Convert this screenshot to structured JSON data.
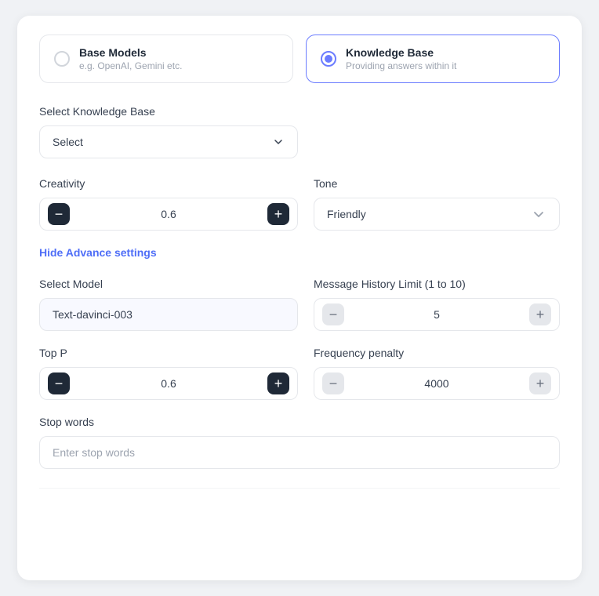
{
  "options": [
    {
      "id": "base-models",
      "title": "Base Models",
      "subtitle": "e.g. OpenAI, Gemini etc.",
      "selected": false
    },
    {
      "id": "knowledge-base",
      "title": "Knowledge Base",
      "subtitle": "Providing answers within it",
      "selected": true
    }
  ],
  "knowledge_base": {
    "label": "Select Knowledge Base",
    "placeholder": "Select",
    "chevron": "▾"
  },
  "creativity": {
    "label": "Creativity",
    "value": "0.6",
    "min_btn": "−",
    "max_btn": "+"
  },
  "tone": {
    "label": "Tone",
    "value": "Friendly",
    "chevron": "⌄"
  },
  "advance_toggle": {
    "label": "Hide Advance settings"
  },
  "select_model": {
    "label": "Select Model",
    "value": "Text-davinci-003"
  },
  "message_history": {
    "label": "Message History Limit (1 to 10)",
    "value": "5",
    "min_btn": "−",
    "max_btn": "+"
  },
  "top_p": {
    "label": "Top P",
    "value": "0.6",
    "min_btn": "−",
    "max_btn": "+"
  },
  "frequency_penalty": {
    "label": "Frequency penalty",
    "value": "4000",
    "min_btn": "−",
    "max_btn": "+"
  },
  "stop_words": {
    "label": "Stop words",
    "placeholder": "Enter stop words"
  }
}
